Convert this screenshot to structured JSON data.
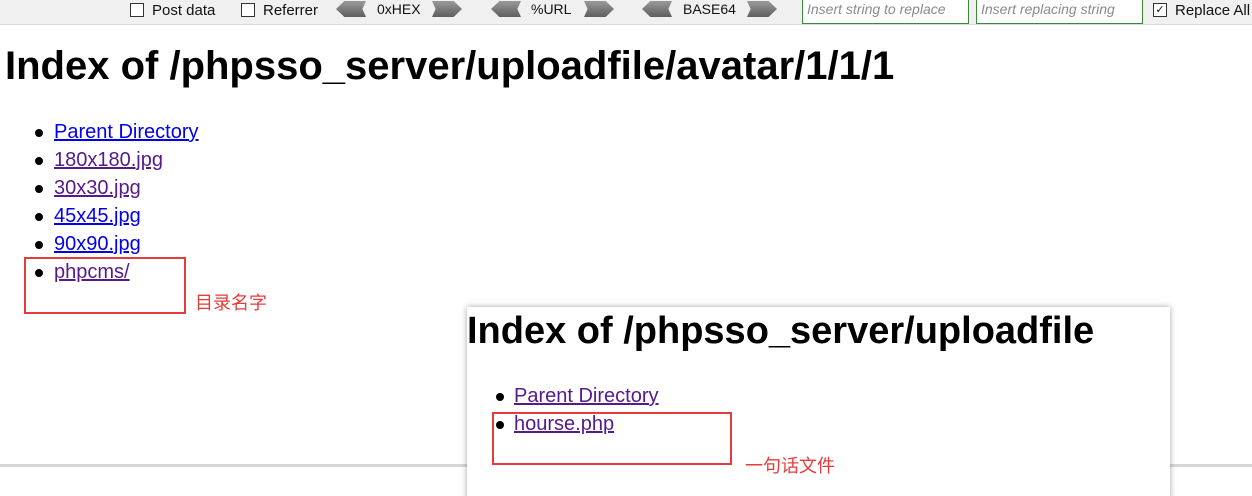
{
  "toolbar": {
    "post_data_label": "Post data",
    "referrer_label": "Referrer",
    "hex_label": "0xHEX",
    "url_label": "%URL",
    "base64_label": "BASE64",
    "replace_input_placeholder": "Insert string to replace",
    "replacing_input_placeholder": "Insert replacing string",
    "replace_all_label": "Replace All",
    "post_data_checked": false,
    "referrer_checked": false,
    "replace_all_checked": true,
    "checkmark": "✓"
  },
  "listing": {
    "title": "Index of /phpsso_server/uploadfile/avatar/1/1/1",
    "items": [
      {
        "label": "Parent Directory",
        "visited": false
      },
      {
        "label": "180x180.jpg",
        "visited": true
      },
      {
        "label": "30x30.jpg",
        "visited": true
      },
      {
        "label": "45x45.jpg",
        "visited": false
      },
      {
        "label": "90x90.jpg",
        "visited": false
      },
      {
        "label": "phpcms/",
        "visited": true
      }
    ],
    "annotation": "目录名字"
  },
  "overlay": {
    "title": "Index of /phpsso_server/uploadfile",
    "items": [
      {
        "label": "Parent Directory",
        "visited": true
      },
      {
        "label": "hourse.php",
        "visited": true
      }
    ],
    "annotation": "一句话文件"
  },
  "colors": {
    "link": "#0000ee",
    "visited_link": "#551a8b",
    "annotation_red": "#e53b3b",
    "input_border": "#3a8a3a"
  }
}
